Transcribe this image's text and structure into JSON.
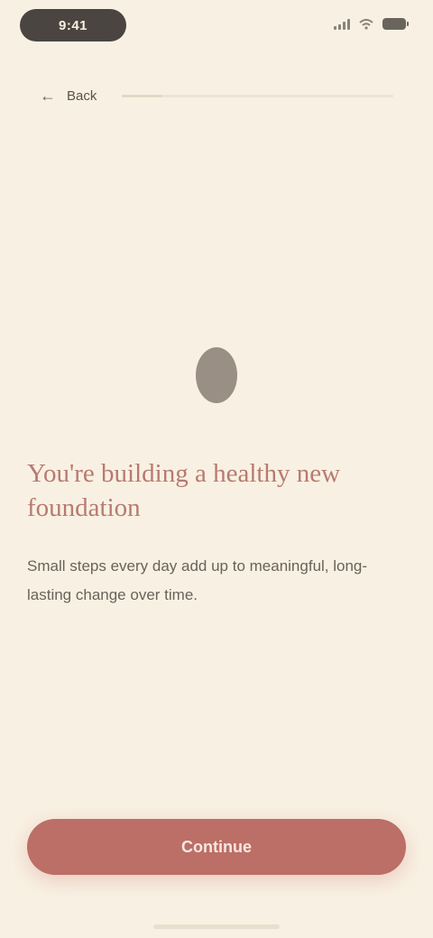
{
  "status_bar": {
    "time": "9:41",
    "icons": [
      "signal-icon",
      "wifi-icon",
      "battery-icon"
    ]
  },
  "topbar": {
    "back_icon": "arrow-left-icon",
    "back_label": "Back",
    "progress_percent": 15
  },
  "main": {
    "icon": "dot-icon",
    "headline": "You're building a healthy new foundation",
    "body": "Small steps every day add up to meaningful, long-lasting change over time."
  },
  "footer": {
    "primary_label": "Continue"
  },
  "colors": {
    "background": "#f8f1e3",
    "accent": "#bb6f66",
    "headline": "#b87a70",
    "body": "#6a625a"
  }
}
